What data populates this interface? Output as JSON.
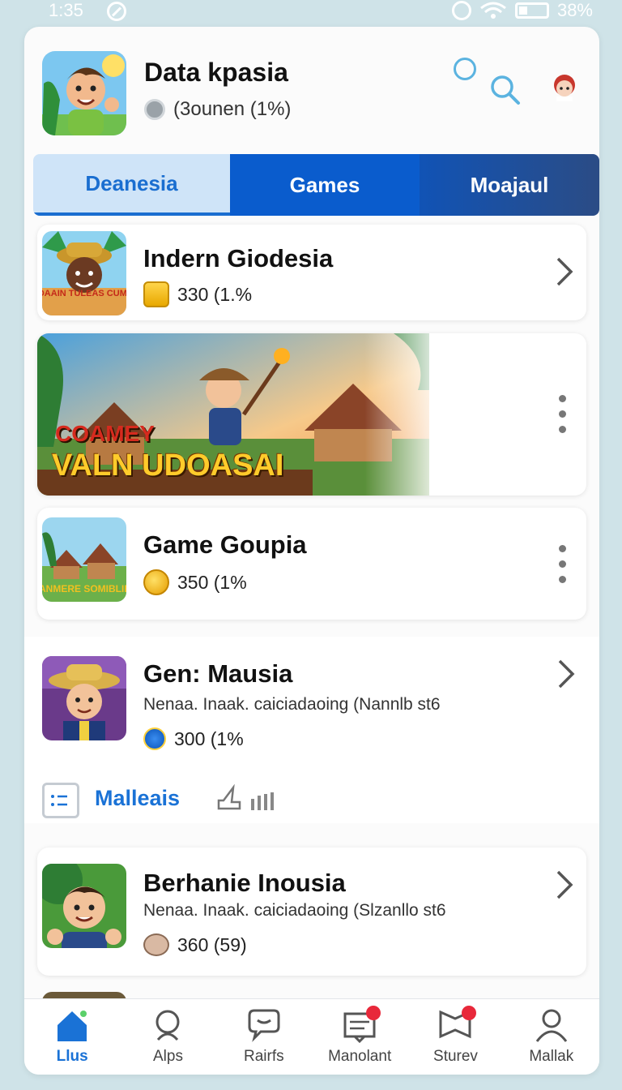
{
  "status_bar": {
    "time": "1:35",
    "battery": "38%"
  },
  "header": {
    "title": "Data kpasia",
    "subtitle": "(3ounen (1%)"
  },
  "tabs": [
    {
      "label": "Deanesia",
      "active": true
    },
    {
      "label": "Games",
      "active": false
    },
    {
      "label": "Moajaul",
      "active": false
    }
  ],
  "items": [
    {
      "title": "Indern Giodesia",
      "meta": "330 (1.%",
      "thumb_text": "GIDAAIN TULEAS CUMAK"
    },
    {
      "title": "Game Goupia",
      "meta": "350 (1%",
      "thumb_text": "MANMERE SOMIBLIER"
    },
    {
      "title": "Gen: Mausia",
      "desc": "Nenaa. Inaak. caiciadaoing (Nannlb st6",
      "meta": "300 (1%"
    },
    {
      "title": "Berhanie Inousia",
      "desc": "Nenaa. Inaak. caiciadaoing (Slzanllo st6",
      "meta": "360 (59)"
    }
  ],
  "banner": {
    "line1": "COAMEY",
    "line2": "VALN UDOASAI"
  },
  "actions": {
    "label": "Malleais"
  },
  "bottom_nav": [
    {
      "label": "Llus",
      "icon": "home-icon",
      "active": true,
      "badge": false
    },
    {
      "label": "Alps",
      "icon": "apps-icon",
      "active": false,
      "badge": false
    },
    {
      "label": "Rairfs",
      "icon": "chat-icon",
      "active": false,
      "badge": false
    },
    {
      "label": "Manolant",
      "icon": "inbox-icon",
      "active": false,
      "badge": true
    },
    {
      "label": "Sturev",
      "icon": "map-icon",
      "active": false,
      "badge": true
    },
    {
      "label": "Mallak",
      "icon": "profile-icon",
      "active": false,
      "badge": false
    }
  ],
  "colors": {
    "accent": "#1a72d6",
    "tab_active_bg": "#cfe4f8",
    "tab_dark": "#0a5ccd",
    "badge": "#e8283a"
  }
}
